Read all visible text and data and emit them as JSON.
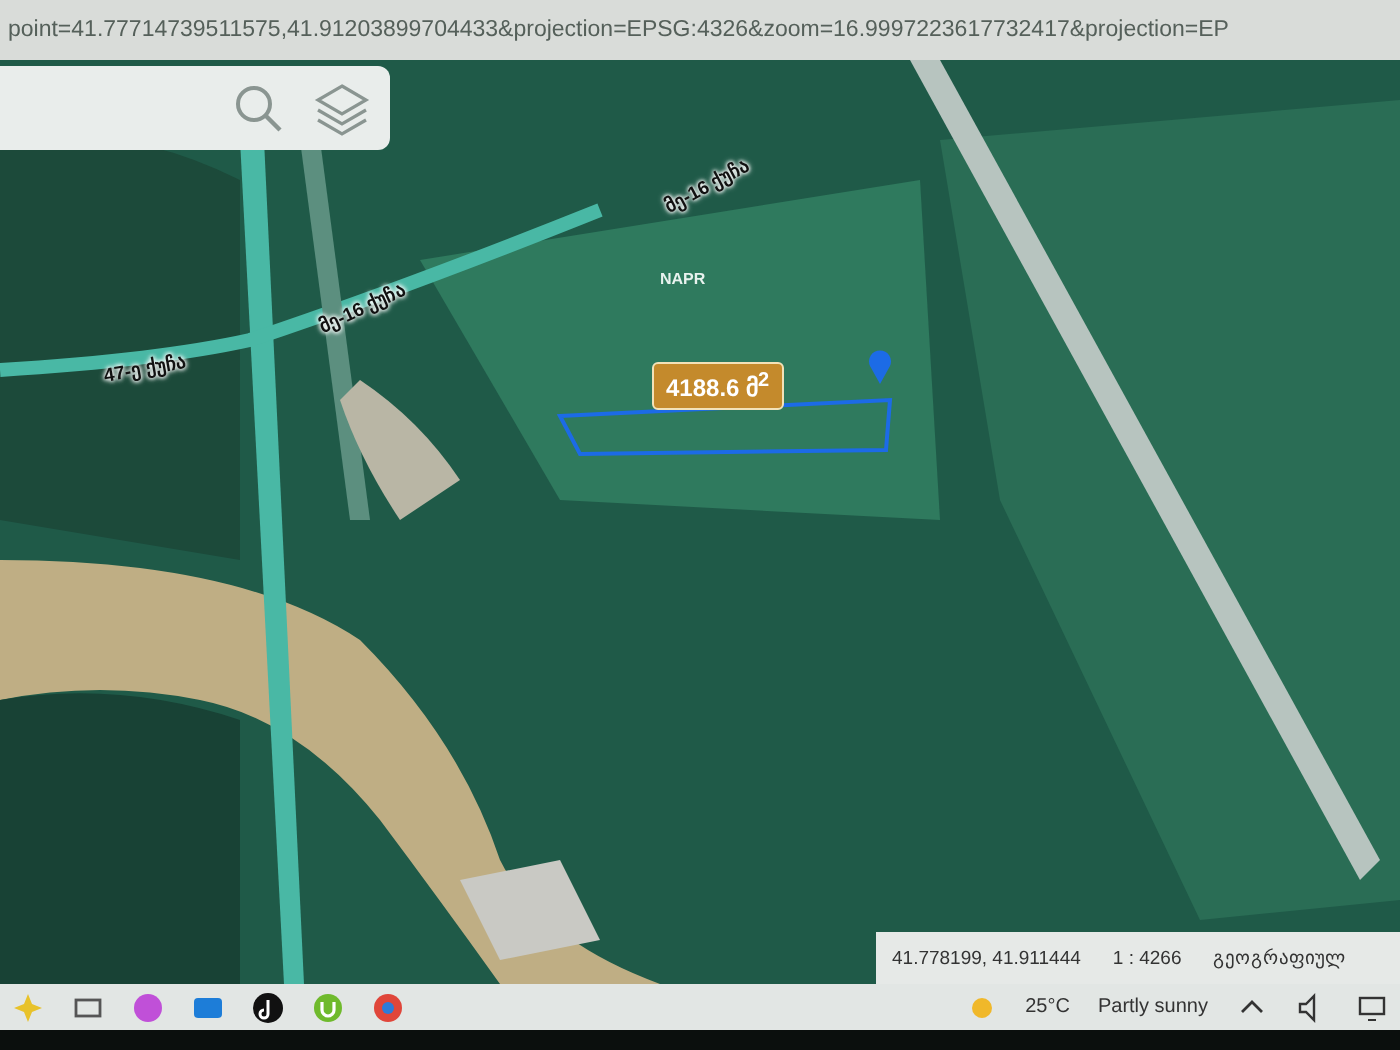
{
  "address_bar": {
    "url": "point=41.77714739511575,41.91203899704433&projection=EPSG:4326&zoom=16.9997223617732417&projection=EP"
  },
  "map": {
    "labels": [
      {
        "kind": "road",
        "text": "მე-16 ქუჩა"
      },
      {
        "kind": "road",
        "text": "მე-16 ქუჩა"
      },
      {
        "kind": "road",
        "text": "47-ე ქუჩა"
      },
      {
        "kind": "place",
        "text": "NAPR"
      }
    ],
    "parcel": {
      "area": "4188.6 მ$^{2}$"
    }
  },
  "status": {
    "coordinates": "41.778199, 41.911444",
    "scale": "1 : 4266",
    "projection_label": "გეოგრაფიულ"
  },
  "taskbar": {
    "temperature": "25°C",
    "condition": "Partly sunny"
  }
}
